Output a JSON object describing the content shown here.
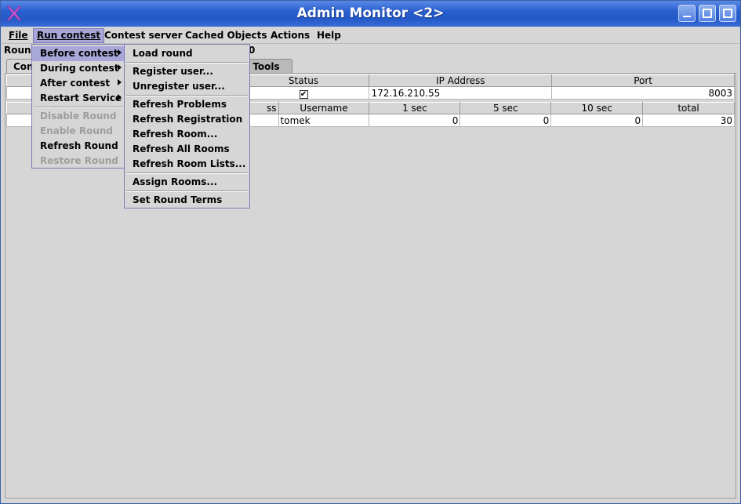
{
  "window": {
    "title": "Admin Monitor <2>"
  },
  "menubar": {
    "items": [
      "File",
      "Run contest",
      "Contest server",
      "Cached Objects",
      "Actions",
      "Help"
    ]
  },
  "header": {
    "round_label": "Round",
    "round_suffix": "0"
  },
  "tabs": {
    "first": "Con",
    "tools": "e Tools"
  },
  "servers_table": {
    "columns": [
      "",
      "Status",
      "IP Address",
      "Port"
    ],
    "rows": [
      {
        "status_checked": true,
        "status_glyph": "✔",
        "ip": "172.16.210.55",
        "port": "8003"
      }
    ]
  },
  "users_table": {
    "columns": [
      "ss",
      "Username",
      "1 sec",
      "5 sec",
      "10 sec",
      "total"
    ],
    "rows": [
      {
        "address": "",
        "username": "tomek",
        "s1": "0",
        "s5": "0",
        "s10": "0",
        "total": "30"
      }
    ]
  },
  "run_contest_menu": {
    "items": [
      {
        "label": "Before contest",
        "enabled": true,
        "submenu": true,
        "highlighted": true
      },
      {
        "label": "During contest",
        "enabled": true,
        "submenu": true
      },
      {
        "label": "After contest",
        "enabled": true,
        "submenu": true
      },
      {
        "label": "Restart Service",
        "enabled": true,
        "submenu": true
      },
      {
        "label": "Disable Round",
        "enabled": false
      },
      {
        "label": "Enable Round",
        "enabled": false
      },
      {
        "label": "Refresh Round",
        "enabled": true
      },
      {
        "label": "Restore Round",
        "enabled": false
      }
    ]
  },
  "before_contest_menu": {
    "items": [
      "Load round",
      "Register user...",
      "Unregister user...",
      "Refresh Problems",
      "Refresh Registration",
      "Refresh Room...",
      "Refresh All Rooms",
      "Refresh Room Lists...",
      "Assign Rooms...",
      "Set Round Terms"
    ]
  },
  "colors": {
    "titlebar": "#2a5fcf",
    "menu_highlight": "#a9a7d8",
    "background": "#d6d6d6"
  }
}
